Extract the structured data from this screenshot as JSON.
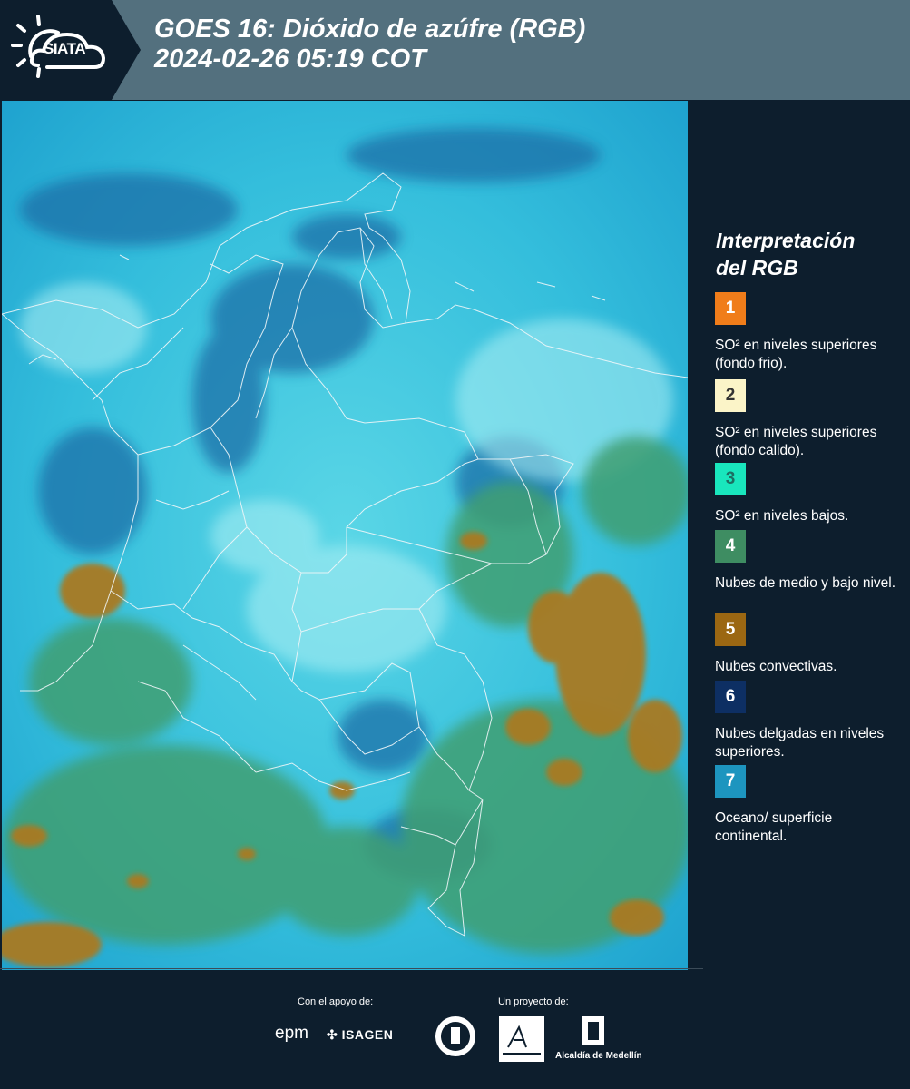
{
  "header": {
    "logo_text": "SIATA",
    "title_line1": "GOES 16: Dióxido de azúfre (RGB)",
    "title_line2": " 2024-02-26 05:19 COT"
  },
  "map": {
    "image_alt": "GOES-16 SO2 RGB satellite composite over Colombia"
  },
  "legend": {
    "title_line1": "Interpretación",
    "title_line2": "del RGB",
    "items": [
      {
        "number": "1",
        "color": "#f07d1a",
        "num_color": "#ffffff",
        "text": "SO² en niveles superiores (fondo frio)."
      },
      {
        "number": "2",
        "color": "#fbf4c8",
        "num_color": "#333333",
        "text": "SO² en niveles superiores (fondo calido)."
      },
      {
        "number": "3",
        "color": "#19e6bd",
        "num_color": "#1d6e62",
        "text": "SO² en niveles bajos."
      },
      {
        "number": "4",
        "color": "#3e8d62",
        "num_color": "#ffffff",
        "text": "Nubes de medio y bajo nivel."
      },
      {
        "number": "5",
        "color": "#9b6712",
        "num_color": "#ffffff",
        "text": "Nubes convectivas."
      },
      {
        "number": "6",
        "color": "#0d2f63",
        "num_color": "#ffffff",
        "text": "Nubes delgadas en niveles superiores."
      },
      {
        "number": "7",
        "color": "#1d95bf",
        "num_color": "#ffffff",
        "text": "Oceano/ superficie continental."
      }
    ]
  },
  "footer": {
    "support_label": "Con el apoyo de:",
    "project_label": "Un proyecto de:",
    "epm": "epm",
    "isagen": "ISAGEN",
    "alcaldia": "Alcaldía de Medellín"
  }
}
